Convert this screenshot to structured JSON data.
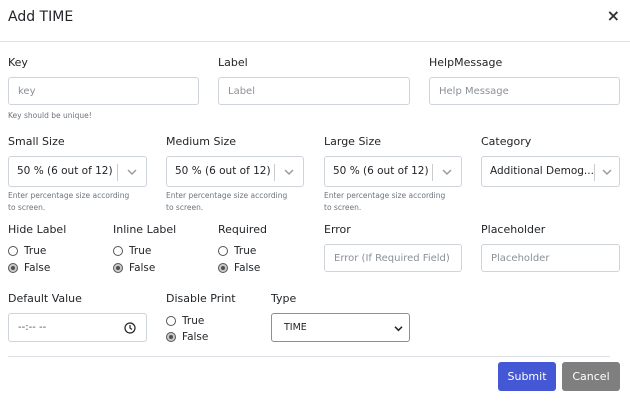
{
  "modal": {
    "title": "Add TIME",
    "close_glyph": "×"
  },
  "key": {
    "label": "Key",
    "placeholder": "key",
    "help": "Key should be unique!"
  },
  "label_field": {
    "label": "Label",
    "placeholder": "Label"
  },
  "help_message": {
    "label": "HelpMessage",
    "placeholder": "Help Message"
  },
  "sizes": {
    "help_line1": "Enter percentage size according",
    "help_line2": "to screen.",
    "small": {
      "label": "Small Size",
      "value": "50 % (6 out of 12)"
    },
    "medium": {
      "label": "Medium Size",
      "value": "50 % (6 out of 12)"
    },
    "large": {
      "label": "Large Size",
      "value": "50 % (6 out of 12)"
    }
  },
  "category": {
    "label": "Category",
    "value": "Additional Demog..."
  },
  "hide_label": {
    "label": "Hide Label",
    "true": "True",
    "false": "False",
    "selected": "False"
  },
  "inline_label": {
    "label": "Inline Label",
    "true": "True",
    "false": "False",
    "selected": "False"
  },
  "required": {
    "label": "Required",
    "true": "True",
    "false": "False",
    "selected": "False"
  },
  "error": {
    "label": "Error",
    "placeholder": "Error (If Required Field)"
  },
  "placeholder_field": {
    "label": "Placeholder",
    "placeholder": "Placeholder"
  },
  "default_value": {
    "label": "Default Value",
    "value": "--:-- --",
    "icon": "clock-icon"
  },
  "disable_print": {
    "label": "Disable Print",
    "true": "True",
    "false": "False",
    "selected": "False"
  },
  "type": {
    "label": "Type",
    "value": "TIME"
  },
  "buttons": {
    "submit": "Submit",
    "cancel": "Cancel"
  },
  "colors": {
    "submit": "#4458d6",
    "cancel": "#7f7f7f",
    "border": "#ced4da"
  }
}
